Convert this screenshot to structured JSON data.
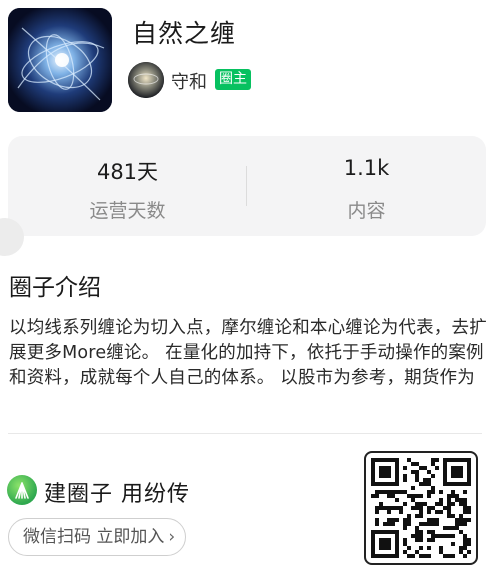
{
  "group": {
    "title": "自然之缠",
    "owner_name": "守和",
    "owner_badge": "圈主"
  },
  "stats": [
    {
      "value": "481天",
      "label": "运营天数"
    },
    {
      "value": "1.1k",
      "label": "内容"
    }
  ],
  "intro": {
    "heading": "圈子介绍",
    "body": "以均线系列缠论为切入点，摩尔缠论和本心缠论为代表，去扩展更多More缠论。  在量化的加持下，依托于手动操作的案例和资料，成就每个人自己的体系。  以股市为参考，期货作为"
  },
  "footer": {
    "brand_text": "建圈子 用纷传",
    "join_label": "微信扫码 立即加入",
    "join_chevron": "›"
  },
  "colors": {
    "accent_green": "#07c160",
    "stats_bg": "#f4f4f5"
  },
  "icons": [
    "chevron-right-icon",
    "brand-leaf-icon",
    "qr-code-icon"
  ]
}
